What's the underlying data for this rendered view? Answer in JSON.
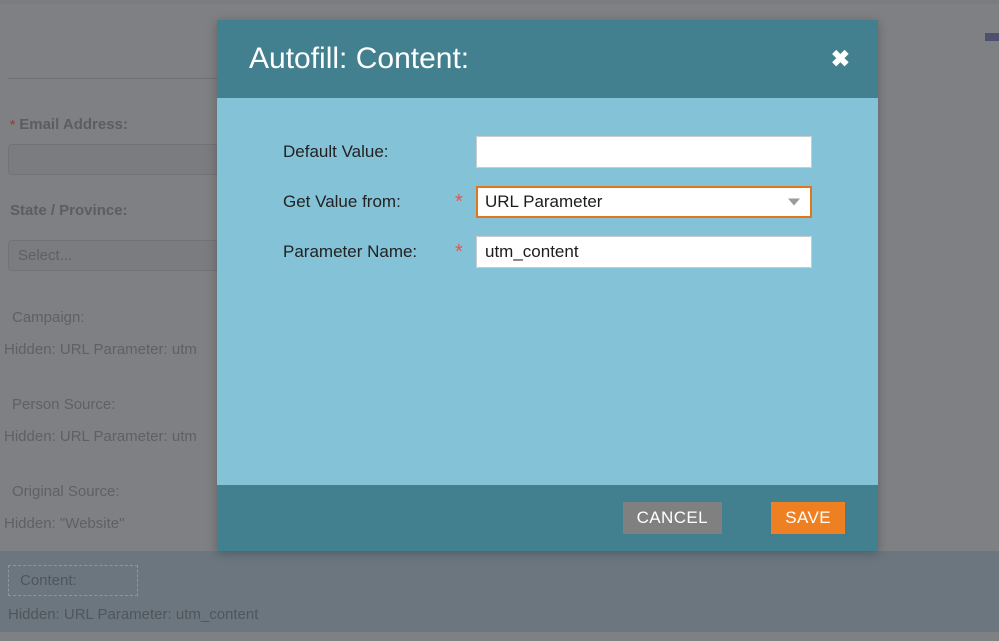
{
  "background_form": {
    "fields": [
      {
        "label": "Email Address:",
        "required": true,
        "value": "",
        "type": "input"
      },
      {
        "label": "State / Province:",
        "required": false,
        "value": "Select...",
        "type": "select"
      }
    ],
    "hidden_fields": [
      {
        "label": "Campaign:",
        "description": "Hidden: URL Parameter: utm"
      },
      {
        "label": "Person Source:",
        "description": "Hidden: URL Parameter: utm"
      },
      {
        "label": "Original Source:",
        "description": "Hidden: \"Website\""
      }
    ],
    "selected_field": {
      "label": "Content:",
      "description": "Hidden: URL Parameter: utm_content"
    }
  },
  "modal": {
    "title": "Autofill: Content:",
    "close_icon": "close-icon",
    "fields": [
      {
        "label": "Default Value:",
        "required": false,
        "value": "",
        "type": "text"
      },
      {
        "label": "Get Value from:",
        "required": true,
        "required_marker": "*",
        "value": "URL Parameter",
        "type": "select",
        "focused": true,
        "caret_icon": "chevron-down-icon"
      },
      {
        "label": "Parameter Name:",
        "required": true,
        "required_marker": "*",
        "value": "utm_content",
        "type": "text"
      }
    ],
    "footer": {
      "cancel_label": "CANCEL",
      "save_label": "SAVE"
    }
  },
  "colors": {
    "modal_header": "#42808f",
    "modal_body": "#84c2d8",
    "modal_footer": "#42808f",
    "save_button": "#ef8022",
    "cancel_button": "#808080",
    "focus_border": "#e2761b",
    "required_star": "#e0594c",
    "overlay": "#7f8083",
    "lower_band": "#6b767f"
  }
}
